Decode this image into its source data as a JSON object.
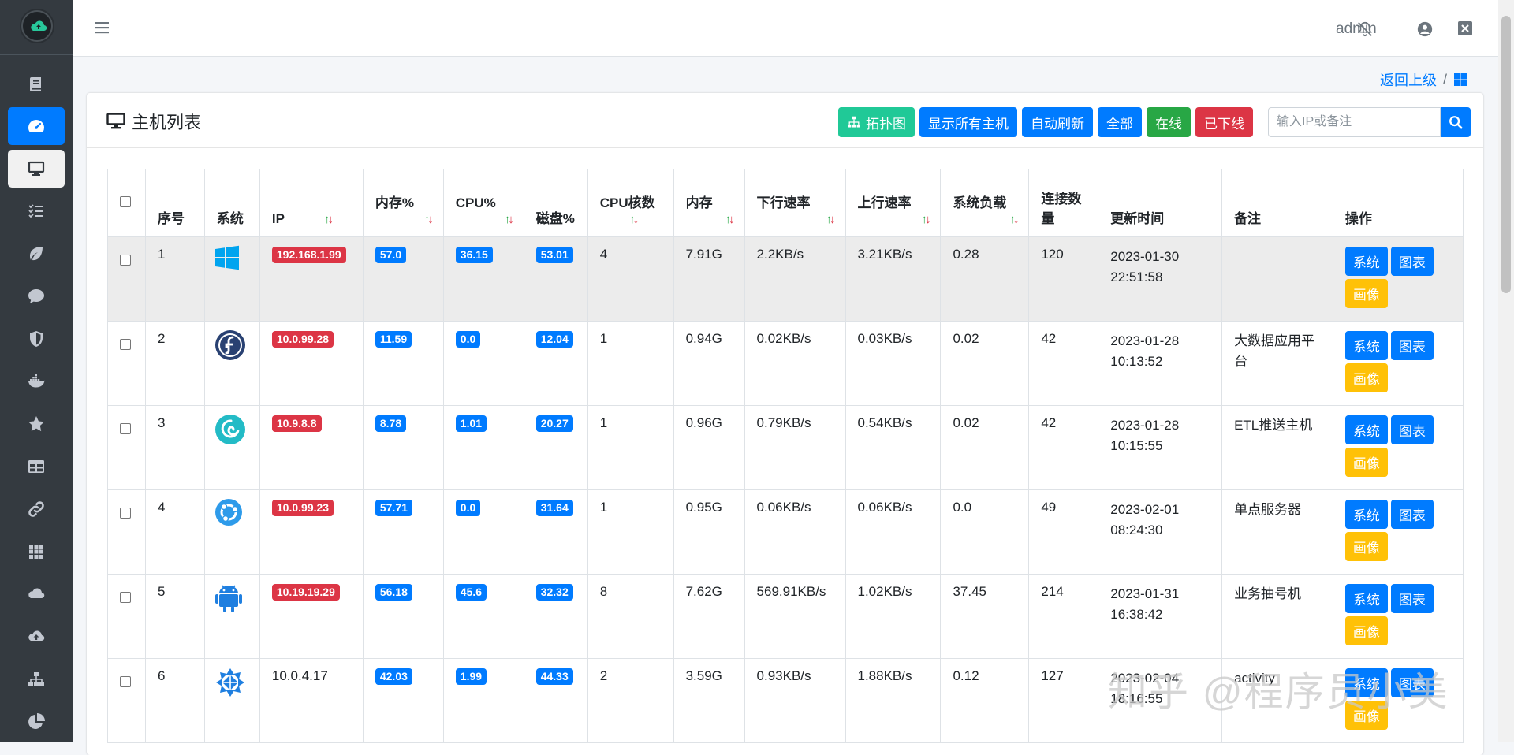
{
  "topbar": {
    "user": "admin"
  },
  "breadcrumb": {
    "back": "返回上级",
    "sep": "/"
  },
  "card": {
    "title": "主机列表"
  },
  "toolbar": {
    "topology": "拓扑图",
    "show_all": "显示所有主机",
    "auto_refresh": "自动刷新",
    "all": "全部",
    "online": "在线",
    "offline": "已下线",
    "search_placeholder": "输入IP或备注"
  },
  "table": {
    "headers": {
      "seq": "序号",
      "os": "系统",
      "ip": "IP",
      "mem_pct": "内存%",
      "cpu_pct": "CPU%",
      "disk_pct": "磁盘%",
      "cpu_cores": "CPU核数",
      "mem": "内存",
      "down": "下行速率",
      "up": "上行速率",
      "load": "系统负载",
      "conns": "连接数量",
      "updated": "更新时间",
      "remark": "备注",
      "ops": "操作"
    },
    "rows": [
      {
        "seq": "1",
        "os": "windows",
        "ip": "192.168.1.99",
        "ip_offline": true,
        "mem": "57.0",
        "cpu": "36.15",
        "disk": "53.01",
        "cores": "4",
        "memsize": "7.91G",
        "down": "2.2KB/s",
        "up": "3.21KB/s",
        "load": "0.28",
        "conns": "120",
        "date": "2023-01-30",
        "time": "22:51:58",
        "remark": ""
      },
      {
        "seq": "2",
        "os": "fedora",
        "ip": "10.0.99.28",
        "ip_offline": true,
        "mem": "11.59",
        "cpu": "0.0",
        "disk": "12.04",
        "cores": "1",
        "memsize": "0.94G",
        "down": "0.02KB/s",
        "up": "0.03KB/s",
        "load": "0.02",
        "conns": "42",
        "date": "2023-01-28",
        "time": "10:13:52",
        "remark": "大数据应用平台"
      },
      {
        "seq": "3",
        "os": "debian",
        "ip": "10.9.8.8",
        "ip_offline": true,
        "mem": "8.78",
        "cpu": "1.01",
        "disk": "20.27",
        "cores": "1",
        "memsize": "0.96G",
        "down": "0.79KB/s",
        "up": "0.54KB/s",
        "load": "0.02",
        "conns": "42",
        "date": "2023-01-28",
        "time": "10:15:55",
        "remark": "ETL推送主机"
      },
      {
        "seq": "4",
        "os": "ubuntu",
        "ip": "10.0.99.23",
        "ip_offline": true,
        "mem": "57.71",
        "cpu": "0.0",
        "disk": "31.64",
        "cores": "1",
        "memsize": "0.95G",
        "down": "0.06KB/s",
        "up": "0.06KB/s",
        "load": "0.0",
        "conns": "49",
        "date": "2023-02-01",
        "time": "08:24:30",
        "remark": "单点服务器"
      },
      {
        "seq": "5",
        "os": "android",
        "ip": "10.19.19.29",
        "ip_offline": true,
        "mem": "56.18",
        "cpu": "45.6",
        "disk": "32.32",
        "cores": "8",
        "memsize": "7.62G",
        "down": "569.91KB/s",
        "up": "1.02KB/s",
        "load": "37.45",
        "conns": "214",
        "date": "2023-01-31",
        "time": "16:38:42",
        "remark": "业务抽号机"
      },
      {
        "seq": "6",
        "os": "centos",
        "ip": "10.0.4.17",
        "ip_offline": false,
        "mem": "42.03",
        "cpu": "1.99",
        "disk": "44.33",
        "cores": "2",
        "memsize": "3.59G",
        "down": "0.93KB/s",
        "up": "1.88KB/s",
        "load": "0.12",
        "conns": "127",
        "date": "2023-02-04",
        "time": "18:16:55",
        "remark": "activity"
      }
    ],
    "op_labels": {
      "system": "系统",
      "chart": "图表",
      "profile": "画像"
    }
  },
  "watermark": "知乎 @程序员小美",
  "colors": {
    "sidebar": "#343a40",
    "primary": "#007bff",
    "teal": "#20c997",
    "success": "#28a745",
    "danger": "#dc3545",
    "warning": "#ffc107"
  }
}
